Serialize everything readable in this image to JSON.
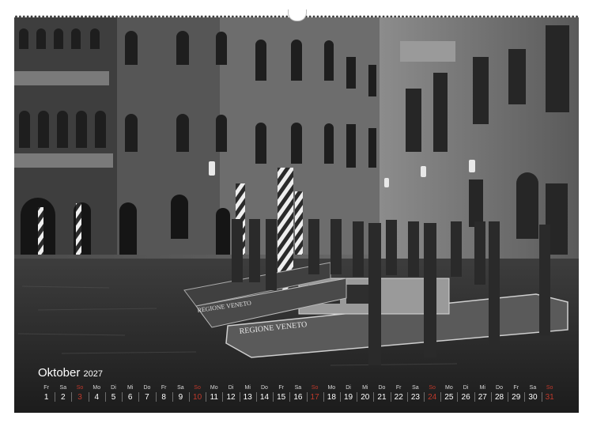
{
  "calendar": {
    "month": "Oktober",
    "year": "2027",
    "days": [
      {
        "wd": "Fr",
        "num": "1"
      },
      {
        "wd": "Sa",
        "num": "2"
      },
      {
        "wd": "So",
        "num": "3"
      },
      {
        "wd": "Mo",
        "num": "4"
      },
      {
        "wd": "Di",
        "num": "5"
      },
      {
        "wd": "Mi",
        "num": "6"
      },
      {
        "wd": "Do",
        "num": "7"
      },
      {
        "wd": "Fr",
        "num": "8"
      },
      {
        "wd": "Sa",
        "num": "9"
      },
      {
        "wd": "So",
        "num": "10"
      },
      {
        "wd": "Mo",
        "num": "11"
      },
      {
        "wd": "Di",
        "num": "12"
      },
      {
        "wd": "Mi",
        "num": "13"
      },
      {
        "wd": "Do",
        "num": "14"
      },
      {
        "wd": "Fr",
        "num": "15"
      },
      {
        "wd": "Sa",
        "num": "16"
      },
      {
        "wd": "So",
        "num": "17"
      },
      {
        "wd": "Mo",
        "num": "18"
      },
      {
        "wd": "Di",
        "num": "19"
      },
      {
        "wd": "Mi",
        "num": "20"
      },
      {
        "wd": "Do",
        "num": "21"
      },
      {
        "wd": "Fr",
        "num": "22"
      },
      {
        "wd": "Sa",
        "num": "23"
      },
      {
        "wd": "So",
        "num": "24"
      },
      {
        "wd": "Mo",
        "num": "25"
      },
      {
        "wd": "Di",
        "num": "26"
      },
      {
        "wd": "Mi",
        "num": "27"
      },
      {
        "wd": "Do",
        "num": "28"
      },
      {
        "wd": "Fr",
        "num": "29"
      },
      {
        "wd": "Sa",
        "num": "30"
      },
      {
        "wd": "So",
        "num": "31"
      }
    ]
  },
  "photo": {
    "boat_name_1": "REGIONE VENETO",
    "boat_name_2": "REGIONE VENETO"
  },
  "colors": {
    "sunday": "#c0392b",
    "text": "#ffffff"
  }
}
